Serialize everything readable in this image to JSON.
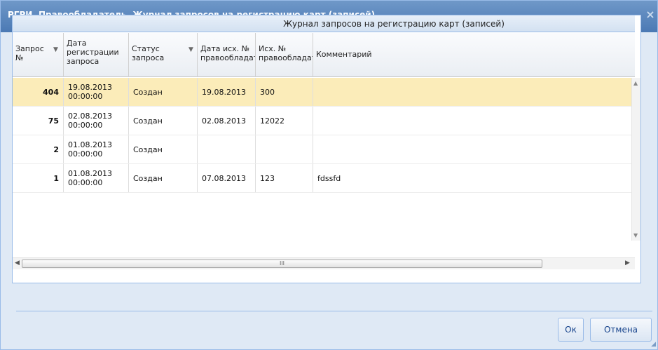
{
  "window": {
    "title": "РГРИ. Правообладатель. Журнал запросов на регистрацию карт (записей)",
    "close_glyph": "×"
  },
  "grid": {
    "caption": "Журнал запросов на регистрацию карт (записей)",
    "columns": [
      {
        "lines": [
          "Запрос",
          "№"
        ],
        "filter": true
      },
      {
        "lines": [
          "Дата",
          "регистрации",
          "запроса"
        ],
        "filter": false
      },
      {
        "lines": [
          "Статус",
          "запроса"
        ],
        "filter": true
      },
      {
        "lines": [
          "Дата исх. №",
          "правообладателя"
        ],
        "filter": false
      },
      {
        "lines": [
          "Исх. №",
          "правообладателя"
        ],
        "filter": false
      },
      {
        "lines": [
          "Комментарий"
        ],
        "filter": false
      }
    ],
    "rows": [
      {
        "id": "404",
        "date": "19.08.2013",
        "time": "00:00:00",
        "status": "Создан",
        "out_date": "19.08.2013",
        "out_no": "300",
        "comment": "",
        "selected": true
      },
      {
        "id": "75",
        "date": "02.08.2013",
        "time": "00:00:00",
        "status": "Создан",
        "out_date": "02.08.2013",
        "out_no": "12022",
        "comment": "",
        "selected": false
      },
      {
        "id": "2",
        "date": "01.08.2013",
        "time": "00:00:00",
        "status": "Создан",
        "out_date": "",
        "out_no": "",
        "comment": "",
        "selected": false
      },
      {
        "id": "1",
        "date": "01.08.2013",
        "time": "00:00:00",
        "status": "Создан",
        "out_date": "07.08.2013",
        "out_no": "123",
        "comment": "fdssfd",
        "selected": false
      }
    ],
    "scroll_grip": "III"
  },
  "buttons": {
    "ok": "Ок",
    "cancel": "Отмена"
  },
  "icons": {
    "filter": "filter-icon",
    "close": "close-icon",
    "scroll_up": "scroll-up-arrow-icon",
    "scroll_down": "scroll-down-arrow-icon",
    "scroll_left": "scroll-left-arrow-icon",
    "scroll_right": "scroll-right-arrow-icon"
  },
  "colors": {
    "title_bar": "#5a86bd",
    "selected_row": "#fbecb9",
    "border": "#99bbe8"
  }
}
